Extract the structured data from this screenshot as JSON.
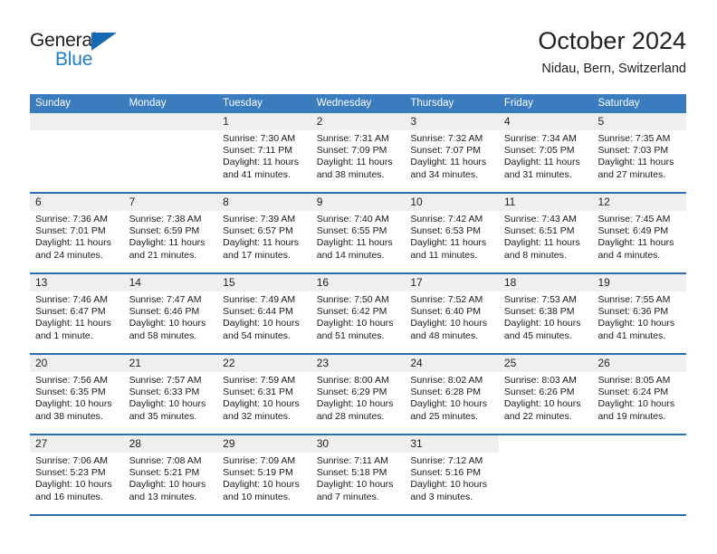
{
  "brand": {
    "name_part1": "General",
    "name_part2": "Blue",
    "triangle_color": "#1668b3",
    "blue_color": "#1f7ec4"
  },
  "header": {
    "title": "October 2024",
    "subtitle": "Nidau, Bern, Switzerland"
  },
  "theme": {
    "header_blue": "#3a7cbe",
    "row_divider_blue": "#2c6fb0",
    "day_band_gray": "#efefef"
  },
  "weekdays": [
    "Sunday",
    "Monday",
    "Tuesday",
    "Wednesday",
    "Thursday",
    "Friday",
    "Saturday"
  ],
  "weeks": [
    [
      {
        "day": "",
        "empty": true
      },
      {
        "day": "",
        "empty": true
      },
      {
        "day": "1",
        "sunrise": "Sunrise: 7:30 AM",
        "sunset": "Sunset: 7:11 PM",
        "daylight_1": "Daylight: 11 hours",
        "daylight_2": "and 41 minutes."
      },
      {
        "day": "2",
        "sunrise": "Sunrise: 7:31 AM",
        "sunset": "Sunset: 7:09 PM",
        "daylight_1": "Daylight: 11 hours",
        "daylight_2": "and 38 minutes."
      },
      {
        "day": "3",
        "sunrise": "Sunrise: 7:32 AM",
        "sunset": "Sunset: 7:07 PM",
        "daylight_1": "Daylight: 11 hours",
        "daylight_2": "and 34 minutes."
      },
      {
        "day": "4",
        "sunrise": "Sunrise: 7:34 AM",
        "sunset": "Sunset: 7:05 PM",
        "daylight_1": "Daylight: 11 hours",
        "daylight_2": "and 31 minutes."
      },
      {
        "day": "5",
        "sunrise": "Sunrise: 7:35 AM",
        "sunset": "Sunset: 7:03 PM",
        "daylight_1": "Daylight: 11 hours",
        "daylight_2": "and 27 minutes."
      }
    ],
    [
      {
        "day": "6",
        "sunrise": "Sunrise: 7:36 AM",
        "sunset": "Sunset: 7:01 PM",
        "daylight_1": "Daylight: 11 hours",
        "daylight_2": "and 24 minutes."
      },
      {
        "day": "7",
        "sunrise": "Sunrise: 7:38 AM",
        "sunset": "Sunset: 6:59 PM",
        "daylight_1": "Daylight: 11 hours",
        "daylight_2": "and 21 minutes."
      },
      {
        "day": "8",
        "sunrise": "Sunrise: 7:39 AM",
        "sunset": "Sunset: 6:57 PM",
        "daylight_1": "Daylight: 11 hours",
        "daylight_2": "and 17 minutes."
      },
      {
        "day": "9",
        "sunrise": "Sunrise: 7:40 AM",
        "sunset": "Sunset: 6:55 PM",
        "daylight_1": "Daylight: 11 hours",
        "daylight_2": "and 14 minutes."
      },
      {
        "day": "10",
        "sunrise": "Sunrise: 7:42 AM",
        "sunset": "Sunset: 6:53 PM",
        "daylight_1": "Daylight: 11 hours",
        "daylight_2": "and 11 minutes."
      },
      {
        "day": "11",
        "sunrise": "Sunrise: 7:43 AM",
        "sunset": "Sunset: 6:51 PM",
        "daylight_1": "Daylight: 11 hours",
        "daylight_2": "and 8 minutes."
      },
      {
        "day": "12",
        "sunrise": "Sunrise: 7:45 AM",
        "sunset": "Sunset: 6:49 PM",
        "daylight_1": "Daylight: 11 hours",
        "daylight_2": "and 4 minutes."
      }
    ],
    [
      {
        "day": "13",
        "sunrise": "Sunrise: 7:46 AM",
        "sunset": "Sunset: 6:47 PM",
        "daylight_1": "Daylight: 11 hours",
        "daylight_2": "and 1 minute."
      },
      {
        "day": "14",
        "sunrise": "Sunrise: 7:47 AM",
        "sunset": "Sunset: 6:46 PM",
        "daylight_1": "Daylight: 10 hours",
        "daylight_2": "and 58 minutes."
      },
      {
        "day": "15",
        "sunrise": "Sunrise: 7:49 AM",
        "sunset": "Sunset: 6:44 PM",
        "daylight_1": "Daylight: 10 hours",
        "daylight_2": "and 54 minutes."
      },
      {
        "day": "16",
        "sunrise": "Sunrise: 7:50 AM",
        "sunset": "Sunset: 6:42 PM",
        "daylight_1": "Daylight: 10 hours",
        "daylight_2": "and 51 minutes."
      },
      {
        "day": "17",
        "sunrise": "Sunrise: 7:52 AM",
        "sunset": "Sunset: 6:40 PM",
        "daylight_1": "Daylight: 10 hours",
        "daylight_2": "and 48 minutes."
      },
      {
        "day": "18",
        "sunrise": "Sunrise: 7:53 AM",
        "sunset": "Sunset: 6:38 PM",
        "daylight_1": "Daylight: 10 hours",
        "daylight_2": "and 45 minutes."
      },
      {
        "day": "19",
        "sunrise": "Sunrise: 7:55 AM",
        "sunset": "Sunset: 6:36 PM",
        "daylight_1": "Daylight: 10 hours",
        "daylight_2": "and 41 minutes."
      }
    ],
    [
      {
        "day": "20",
        "sunrise": "Sunrise: 7:56 AM",
        "sunset": "Sunset: 6:35 PM",
        "daylight_1": "Daylight: 10 hours",
        "daylight_2": "and 38 minutes."
      },
      {
        "day": "21",
        "sunrise": "Sunrise: 7:57 AM",
        "sunset": "Sunset: 6:33 PM",
        "daylight_1": "Daylight: 10 hours",
        "daylight_2": "and 35 minutes."
      },
      {
        "day": "22",
        "sunrise": "Sunrise: 7:59 AM",
        "sunset": "Sunset: 6:31 PM",
        "daylight_1": "Daylight: 10 hours",
        "daylight_2": "and 32 minutes."
      },
      {
        "day": "23",
        "sunrise": "Sunrise: 8:00 AM",
        "sunset": "Sunset: 6:29 PM",
        "daylight_1": "Daylight: 10 hours",
        "daylight_2": "and 28 minutes."
      },
      {
        "day": "24",
        "sunrise": "Sunrise: 8:02 AM",
        "sunset": "Sunset: 6:28 PM",
        "daylight_1": "Daylight: 10 hours",
        "daylight_2": "and 25 minutes."
      },
      {
        "day": "25",
        "sunrise": "Sunrise: 8:03 AM",
        "sunset": "Sunset: 6:26 PM",
        "daylight_1": "Daylight: 10 hours",
        "daylight_2": "and 22 minutes."
      },
      {
        "day": "26",
        "sunrise": "Sunrise: 8:05 AM",
        "sunset": "Sunset: 6:24 PM",
        "daylight_1": "Daylight: 10 hours",
        "daylight_2": "and 19 minutes."
      }
    ],
    [
      {
        "day": "27",
        "sunrise": "Sunrise: 7:06 AM",
        "sunset": "Sunset: 5:23 PM",
        "daylight_1": "Daylight: 10 hours",
        "daylight_2": "and 16 minutes."
      },
      {
        "day": "28",
        "sunrise": "Sunrise: 7:08 AM",
        "sunset": "Sunset: 5:21 PM",
        "daylight_1": "Daylight: 10 hours",
        "daylight_2": "and 13 minutes."
      },
      {
        "day": "29",
        "sunrise": "Sunrise: 7:09 AM",
        "sunset": "Sunset: 5:19 PM",
        "daylight_1": "Daylight: 10 hours",
        "daylight_2": "and 10 minutes."
      },
      {
        "day": "30",
        "sunrise": "Sunrise: 7:11 AM",
        "sunset": "Sunset: 5:18 PM",
        "daylight_1": "Daylight: 10 hours",
        "daylight_2": "and 7 minutes."
      },
      {
        "day": "31",
        "sunrise": "Sunrise: 7:12 AM",
        "sunset": "Sunset: 5:16 PM",
        "daylight_1": "Daylight: 10 hours",
        "daylight_2": "and 3 minutes."
      },
      {
        "day": "",
        "empty": true
      },
      {
        "day": "",
        "empty": true
      }
    ]
  ]
}
